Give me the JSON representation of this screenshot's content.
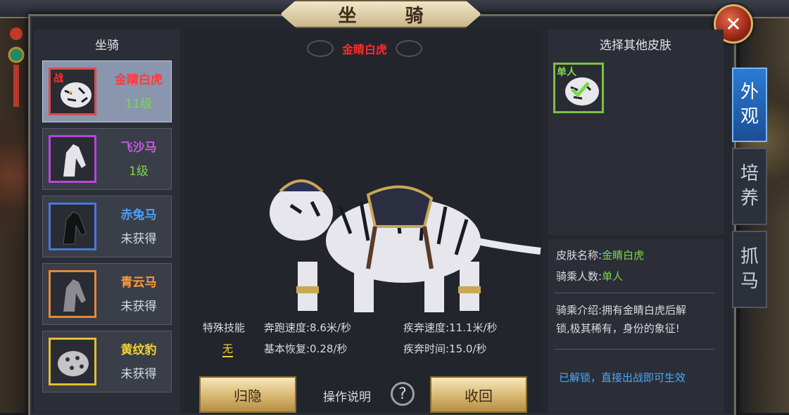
{
  "window": {
    "title": "坐 骑",
    "close_icon": "close-x-icon"
  },
  "left_panel": {
    "header": "坐骑",
    "mounts": [
      {
        "name": "金睛白虎",
        "status": "11级",
        "name_color": "#ff3b3b",
        "status_color": "#7cd84a",
        "frame_color": "#e04a4a",
        "tag": "战",
        "selected": true,
        "icon": "white-tiger-icon"
      },
      {
        "name": "飞沙马",
        "status": "1级",
        "name_color": "#c558e8",
        "status_color": "#7cd84a",
        "frame_color": "#b548d8",
        "icon": "white-horse-icon"
      },
      {
        "name": "赤兔马",
        "status": "未获得",
        "name_color": "#4aa0ff",
        "status_color": "#d8dce2",
        "frame_color": "#4a78d8",
        "icon": "dark-horse-icon"
      },
      {
        "name": "青云马",
        "status": "未获得",
        "name_color": "#ff9a3c",
        "status_color": "#d8dce2",
        "frame_color": "#e08a3a",
        "icon": "grey-horse-icon"
      },
      {
        "name": "黄纹豹",
        "status": "未获得",
        "name_color": "#f2d23a",
        "status_color": "#d8dce2",
        "frame_color": "#e0c030",
        "icon": "leopard-icon"
      }
    ]
  },
  "preview": {
    "mount_name": "金睛白虎",
    "model": "white-tiger-mount-model",
    "special_skill_label": "特殊技能",
    "special_skill_value": "无",
    "run_speed": "奔跑速度:8.6米/秒",
    "sprint_speed": "疾奔速度:11.1米/秒",
    "base_recovery": "基本恢复:0.28/秒",
    "sprint_time": "疾奔时间:15.0/秒"
  },
  "actions": {
    "hide_label": "归隐",
    "help_label": "操作说明",
    "help_icon": "question-icon",
    "recall_label": "收回"
  },
  "skins": {
    "header": "选择其他皮肤",
    "items": [
      {
        "tag": "单人",
        "icon": "white-tiger-icon",
        "checked": true
      }
    ]
  },
  "skin_info": {
    "name_label": "皮肤名称:",
    "name_value": "金睛白虎",
    "riders_label": "骑乘人数:",
    "riders_value": "单人",
    "desc_line1": "骑乘介绍:拥有金睛白虎后解",
    "desc_line2": "锁,极其稀有，身份的象征!",
    "unlock_note": "已解锁，直接出战即可生效"
  },
  "side_tabs": [
    {
      "label_1": "外",
      "label_2": "观",
      "active": true
    },
    {
      "label_1": "培",
      "label_2": "养",
      "active": false
    },
    {
      "label_1": "抓",
      "label_2": "马",
      "active": false
    }
  ],
  "colors": {
    "accent_red": "#ff2a2a",
    "accent_green": "#7cd84a",
    "link_blue": "#4aa8ff",
    "gold": "#d5b26a"
  }
}
